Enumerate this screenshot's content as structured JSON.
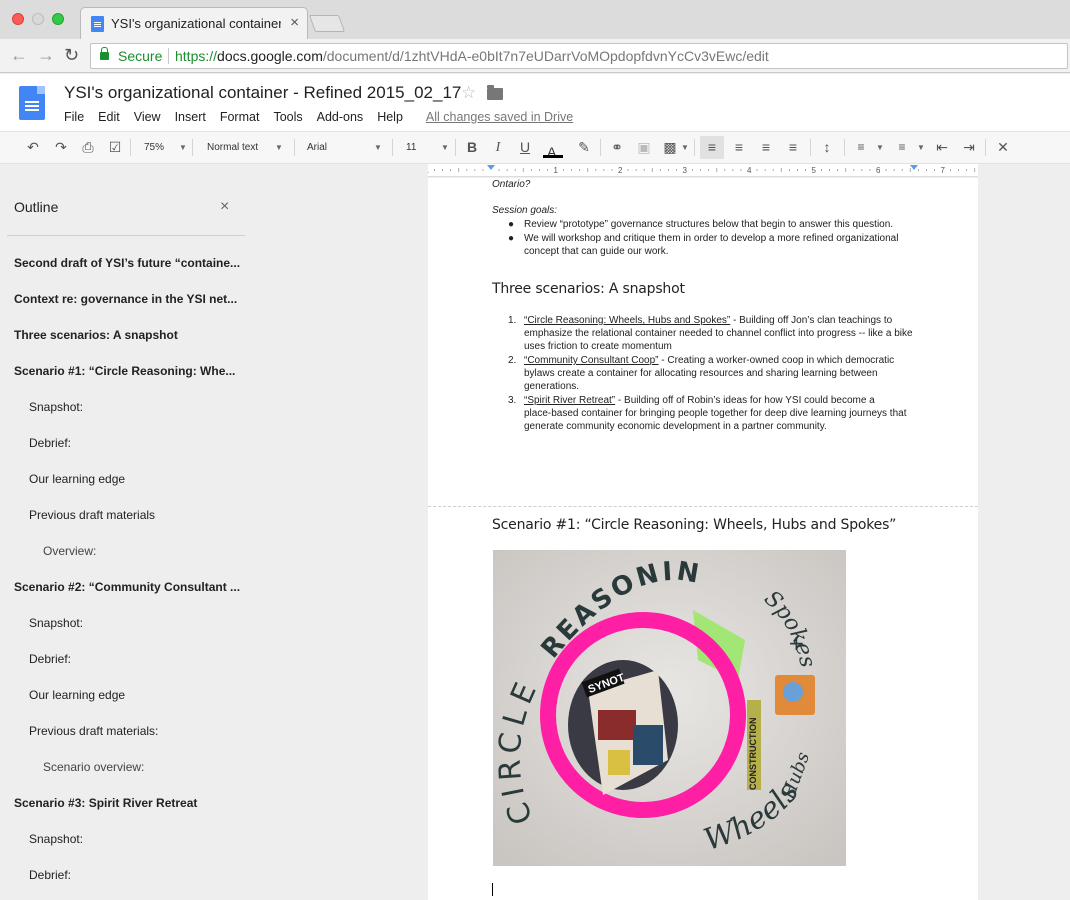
{
  "browser": {
    "tab_title": "YSI's organizational container - Refined 2015_02_17",
    "tab_close": "×",
    "secure_label": "Secure",
    "url_scheme": "https://",
    "url_host": "docs.google.com",
    "url_path": "/document/d/1zhtVHdA-e0bIt7n7eUDarrVoMOpdopfdvnYcCv3vEwc/edit"
  },
  "docs": {
    "title": "YSI's organizational container - Refined 2015_02_17",
    "menu": [
      "File",
      "Edit",
      "View",
      "Insert",
      "Format",
      "Tools",
      "Add-ons",
      "Help"
    ],
    "saved_status": "All changes saved in Drive"
  },
  "toolbar": {
    "zoom": "75%",
    "style": "Normal text",
    "font": "Arial",
    "size": "11",
    "bold": "B",
    "italic": "I",
    "underline": "U",
    "text_color": "A"
  },
  "ruler": {
    "labels": [
      "1",
      "1",
      "2",
      "3",
      "4",
      "5",
      "6",
      "7"
    ]
  },
  "outline": {
    "title": "Outline",
    "close": "×",
    "items": [
      {
        "level": 1,
        "text": "Second draft of YSI’s future “containe..."
      },
      {
        "level": 1,
        "text": "Context re: governance in the YSI net..."
      },
      {
        "level": 1,
        "text": "Three scenarios: A snapshot"
      },
      {
        "level": 1,
        "text": "Scenario #1: “Circle Reasoning: Whe..."
      },
      {
        "level": 2,
        "text": "Snapshot:"
      },
      {
        "level": 2,
        "text": "Debrief:"
      },
      {
        "level": 2,
        "text": "Our learning edge"
      },
      {
        "level": 2,
        "text": "Previous draft materials"
      },
      {
        "level": 3,
        "text": "Overview:"
      },
      {
        "level": 1,
        "text": "Scenario #2: “Community Consultant ..."
      },
      {
        "level": 2,
        "text": "Snapshot:"
      },
      {
        "level": 2,
        "text": "Debrief:"
      },
      {
        "level": 2,
        "text": "Our learning edge"
      },
      {
        "level": 2,
        "text": "Previous draft materials:"
      },
      {
        "level": 3,
        "text": "Scenario overview:"
      },
      {
        "level": 1,
        "text": "Scenario #3: Spirit River Retreat"
      },
      {
        "level": 2,
        "text": "Snapshot:"
      },
      {
        "level": 2,
        "text": "Debrief:"
      }
    ]
  },
  "document": {
    "ontario": "Ontario?",
    "session_goals_label": "Session goals:",
    "goals": [
      "Review “prototype” governance structures below that begin to answer this question.",
      "We will workshop and critique them in order to develop a more refined organizational",
      "concept that can guide our work."
    ],
    "heading_three": "Three scenarios: A snapshot",
    "scenarios": [
      {
        "num": "1.",
        "link": "“Circle Reasoning: Wheels, Hubs and Spokes”",
        "rest": " - Building off Jon’s clan teachings to",
        "lines": [
          "emphasize the relational container needed to channel conflict into progress -- like a bike",
          "uses friction to create momentum"
        ]
      },
      {
        "num": "2.",
        "link": "“Community Consultant Coop”",
        "rest": " - Creating a worker-owned coop in which democratic",
        "lines": [
          "bylaws create a container for allocating resources and sharing learning between",
          "generations."
        ]
      },
      {
        "num": "3.",
        "link": "“Spirit River Retreat”",
        "rest": " - Building off of Robin’s ideas for how YSI could become a",
        "lines": [
          "place-based container for bringing people together for deep dive learning journeys that",
          "generate community economic development in a partner community."
        ]
      }
    ],
    "heading_scenario1": "Scenario #1: “Circle Reasoning: Wheels, Hubs and Spokes”",
    "collage": {
      "word_reasoning": "REASONING",
      "word_circle": "CIRCLE",
      "word_spokes": "Spokes",
      "word_hubs": "Hubs",
      "word_plus": "+",
      "word_wheels": "Wheels",
      "word_construction": "CONSTRUCTION"
    }
  },
  "colors": {
    "accent_green": "#1a8f2d",
    "docs_blue": "#4285f4",
    "magenta": "#ff1fa4"
  }
}
